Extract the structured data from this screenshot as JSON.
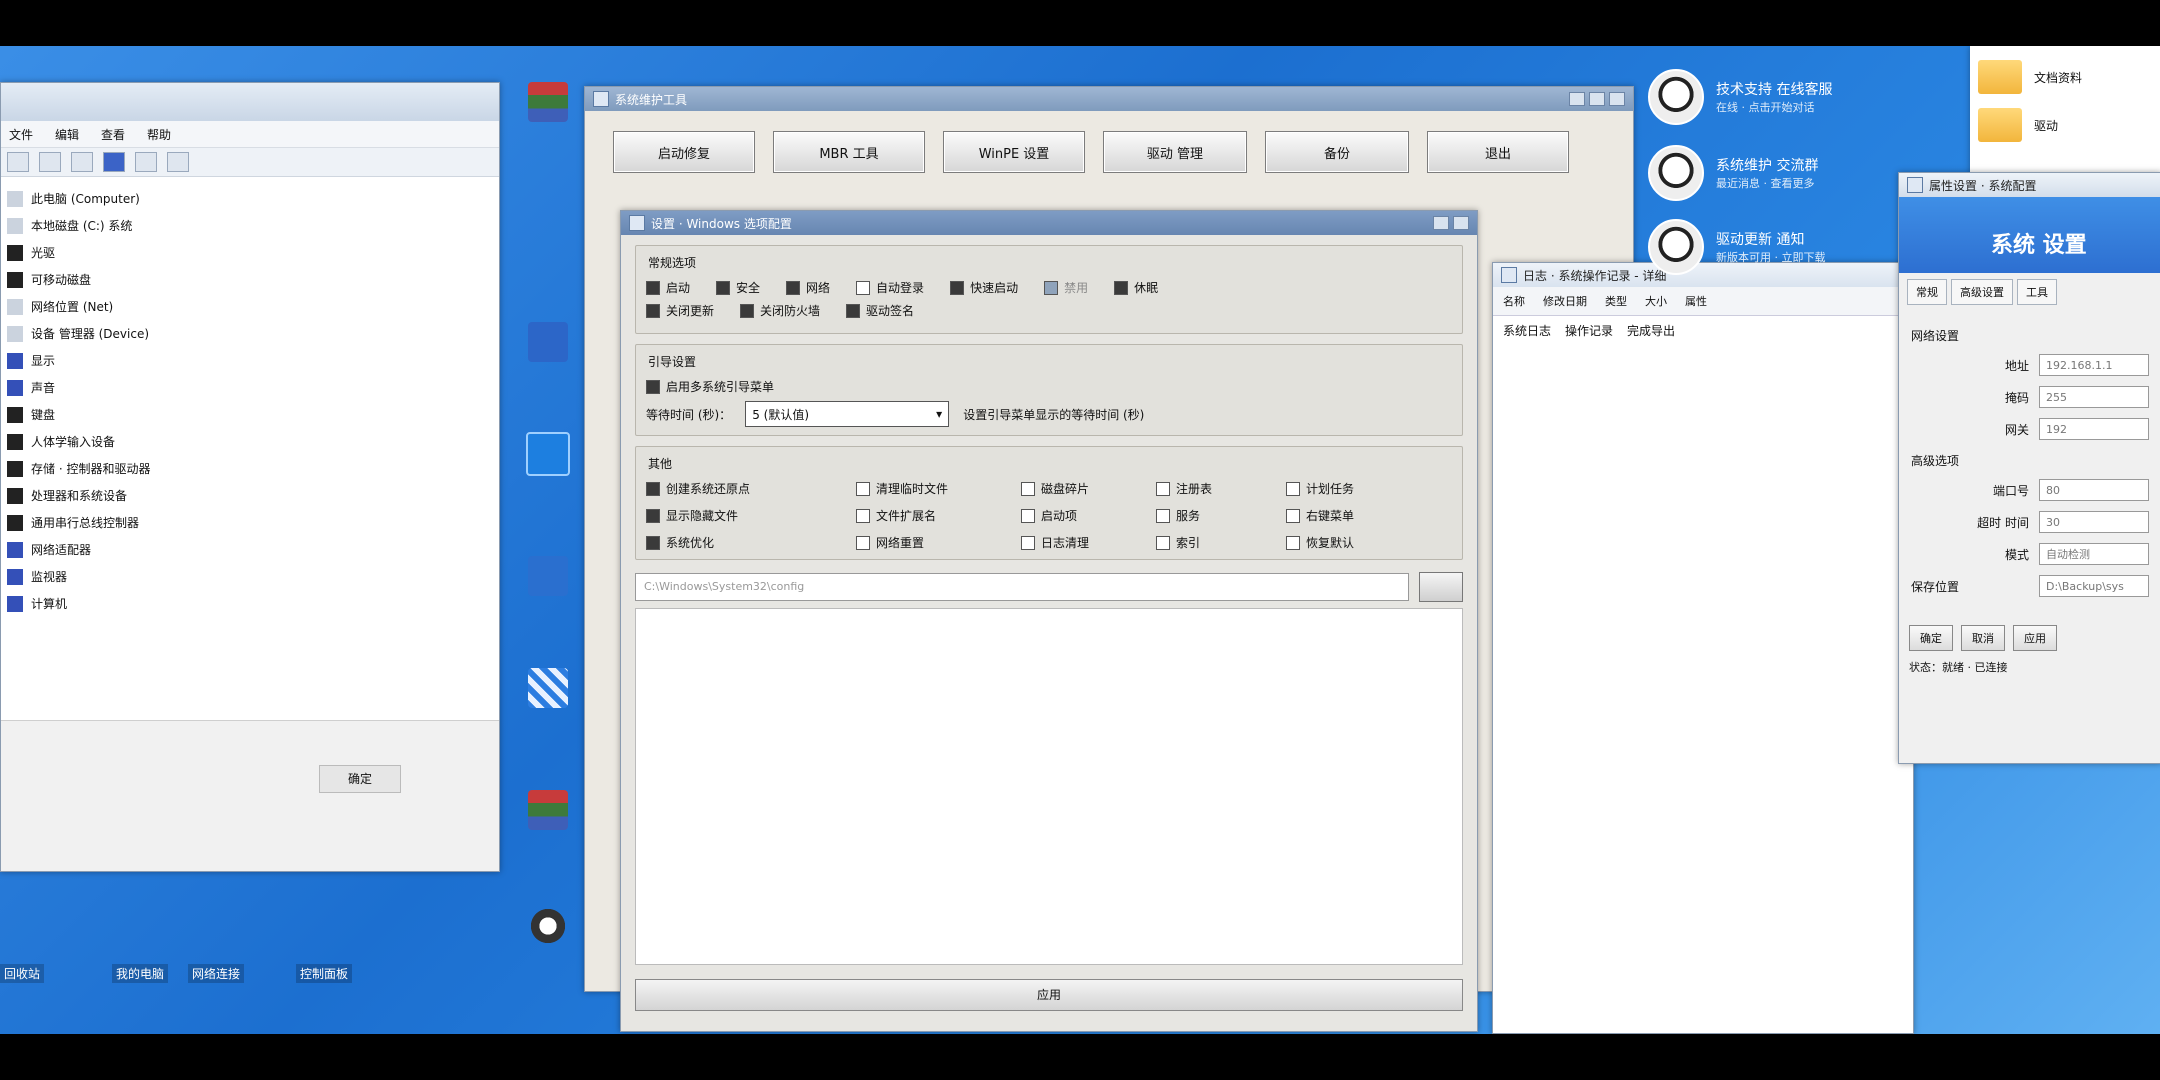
{
  "explorer": {
    "menu": [
      "文件",
      "编辑",
      "查看",
      "帮助"
    ],
    "tree": [
      {
        "label": "此电脑 (Computer)",
        "icon": "light"
      },
      {
        "label": "本地磁盘 (C:) 系统",
        "icon": "light"
      },
      {
        "label": "光驱",
        "icon": "dark"
      },
      {
        "label": "可移动磁盘",
        "icon": "dark"
      },
      {
        "label": "网络位置 (Net)",
        "icon": "light"
      },
      {
        "label": "设备 管理器 (Device)",
        "icon": "light"
      },
      {
        "label": "显示",
        "icon": "blue"
      },
      {
        "label": "声音",
        "icon": "blue"
      },
      {
        "label": "键盘",
        "icon": "dark"
      },
      {
        "label": "人体学输入设备",
        "icon": "dark"
      },
      {
        "label": "存储 · 控制器和驱动器",
        "icon": "dark"
      },
      {
        "label": "处理器和系统设备",
        "icon": "dark"
      },
      {
        "label": "通用串行总线控制器",
        "icon": "dark"
      },
      {
        "label": "网络适配器",
        "icon": "blue"
      },
      {
        "label": "监视器",
        "icon": "blue"
      },
      {
        "label": "计算机",
        "icon": "blue"
      }
    ],
    "status_button": "确定"
  },
  "desktop": {
    "labels": [
      "回收站",
      "我的电脑",
      "网络连接",
      "控制面板"
    ]
  },
  "main": {
    "title": "系统维护工具",
    "buttons": [
      "启动修复",
      "MBR 工具",
      "WinPE 设置",
      "驱动 管理",
      "备份",
      "退出"
    ]
  },
  "dialog": {
    "title": "设置 · Windows 选项配置",
    "group1": {
      "title": "常规选项",
      "row1": [
        {
          "label": "启动",
          "checked": true
        },
        {
          "label": "安全",
          "checked": true
        },
        {
          "label": "网络",
          "checked": true
        },
        {
          "label": "自动登录",
          "checked": false
        },
        {
          "label": "快速启动",
          "checked": true
        },
        {
          "label": "禁用",
          "checked": true,
          "disabled": true
        },
        {
          "label": "休眠",
          "checked": true
        }
      ],
      "row2": [
        {
          "label": "关闭更新",
          "checked": true
        },
        {
          "label": "关闭防火墙",
          "checked": true
        },
        {
          "label": "驱动签名",
          "checked": true
        }
      ]
    },
    "group2": {
      "title": "引导设置",
      "checkbox": "启用多系统引导菜单",
      "input_label": "等待时间 (秒)：",
      "input_value": "5 (默认值)",
      "hint": "设置引导菜单显示的等待时间 (秒)"
    },
    "group3": {
      "title": "其他",
      "items": [
        "创建系统还原点",
        "清理临时文件",
        "磁盘碎片",
        "注册表",
        "计划任务",
        "显示隐藏文件",
        "文件扩展名",
        "启动项",
        "服务",
        "右键菜单",
        "系统优化",
        "网络重置",
        "日志清理",
        "索引",
        "恢复默认"
      ]
    },
    "path_placeholder": "C:\\Windows\\System32\\config",
    "bottom_button": "应用"
  },
  "listwin": {
    "title": "日志 · 系统操作记录 - 详细",
    "headers": [
      "名称",
      "修改日期",
      "类型",
      "大小",
      "属性"
    ],
    "rows": [
      [
        "系统日志",
        "操作记录",
        "完成导出"
      ]
    ]
  },
  "contacts": [
    {
      "name": "技术支持 在线客服",
      "status": "在线 · 点击开始对话"
    },
    {
      "name": "系统维护 交流群",
      "status": "最近消息 · 查看更多"
    },
    {
      "name": "驱动更新 通知",
      "status": "新版本可用 · 立即下载"
    }
  ],
  "folders": [
    "文档资料",
    "驱动"
  ],
  "props": {
    "title": "属性设置 · 系统配置",
    "banner": "系统 设置",
    "tabs": [
      "常规",
      "高级设置",
      "工具"
    ],
    "section1": "网络设置",
    "fields": [
      {
        "label": "地址",
        "value": "192.168.1.1"
      },
      {
        "label": "掩码",
        "value": "255"
      },
      {
        "label": "网关",
        "value": "192"
      }
    ],
    "section2": "高级选项",
    "fields2": [
      {
        "label": "端口号",
        "value": "80"
      },
      {
        "label": "超时 时间",
        "value": "30"
      },
      {
        "label": "模式",
        "value": "自动检测"
      }
    ],
    "path_label": "保存位置",
    "path_value": "D:\\Backup\\sys",
    "buttons": [
      "确定",
      "取消",
      "应用"
    ],
    "footer": "状态：就绪 · 已连接"
  }
}
